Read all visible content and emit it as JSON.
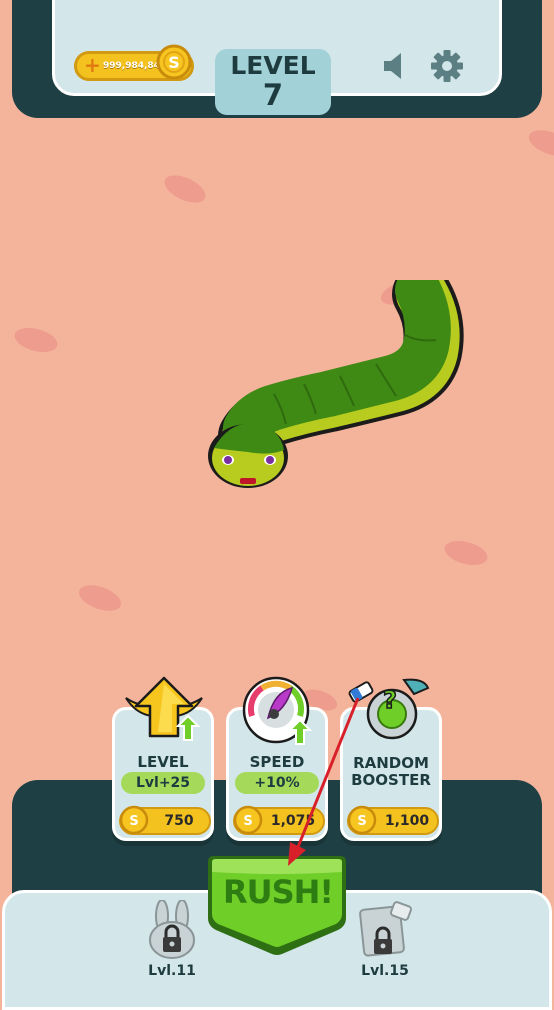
{
  "top_bar": {
    "coins": "999,984,845",
    "level_label": "LEVEL",
    "level_number": "7",
    "sound_icon": "speaker-icon",
    "settings_icon": "gear-icon"
  },
  "boosters": [
    {
      "title": "LEVEL",
      "subtitle": "Lvl+25",
      "price": "750",
      "icon": "winged-arrow-icon"
    },
    {
      "title": "SPEED",
      "subtitle": "+10%",
      "price": "1,075",
      "icon": "speedometer-icon"
    },
    {
      "title_line1": "RANDOM",
      "title_line2": "BOOSTER",
      "price": "1,100",
      "icon": "mystery-booster-icon"
    }
  ],
  "rush_button": {
    "label": "RUSH!"
  },
  "locked_items": [
    {
      "label": "Lvl.11",
      "icon": "locked-bunny-skin-icon"
    },
    {
      "label": "Lvl.15",
      "icon": "locked-item-icon"
    }
  ],
  "colors": {
    "background": "#f4b49c",
    "panel_dark": "#1e3f43",
    "panel_light": "#d3e7ea",
    "snake_green": "#3f8a14",
    "snake_belly": "#b3c81c",
    "rush_green": "#6fce27",
    "coin_gold": "#f4c21f"
  }
}
